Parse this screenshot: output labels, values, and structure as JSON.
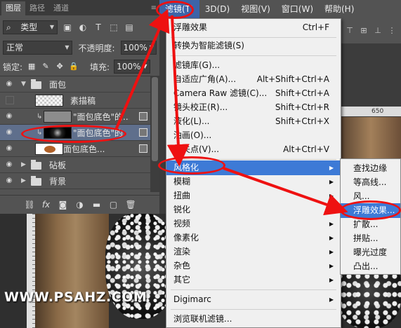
{
  "layers_panel": {
    "tabs": [
      "图层",
      "路径",
      "通道"
    ],
    "filter_kind": "类型",
    "blend_mode": "正常",
    "opacity_label": "不透明度:",
    "opacity_value": "100%",
    "lock_label": "锁定:",
    "fill_label": "填充:",
    "fill_value": "100%",
    "layers": [
      {
        "name": "面包",
        "type": "group",
        "expanded": true,
        "visible": true
      },
      {
        "name": "素描稿",
        "type": "layer",
        "visible": false
      },
      {
        "name": "\"面包底色\"的...",
        "type": "smart-object",
        "visible": true
      },
      {
        "name": "\"面包底色\"的",
        "type": "smart-object",
        "visible": true,
        "selected": true
      },
      {
        "name": "面包底色...",
        "type": "layer",
        "visible": true
      },
      {
        "name": "砧板",
        "type": "group",
        "expanded": false,
        "visible": true
      },
      {
        "name": "背景",
        "type": "group",
        "expanded": false,
        "visible": true
      }
    ]
  },
  "menubar": {
    "items": [
      "滤镜(T)",
      "3D(D)",
      "视图(V)",
      "窗口(W)",
      "帮助(H)"
    ],
    "open_item": "滤镜(T)"
  },
  "filter_menu": {
    "items": [
      {
        "label": "浮雕效果",
        "shortcut": "Ctrl+F"
      },
      {
        "label": "转换为智能滤镜(S)"
      },
      {
        "label": "滤镜库(G)..."
      },
      {
        "label": "自适应广角(A)...",
        "shortcut": "Alt+Shift+Ctrl+A"
      },
      {
        "label": "Camera Raw 滤镜(C)...",
        "shortcut": "Shift+Ctrl+A"
      },
      {
        "label": "镜头校正(R)...",
        "shortcut": "Shift+Ctrl+R"
      },
      {
        "label": "液化(L)...",
        "shortcut": "Shift+Ctrl+X"
      },
      {
        "label": "油画(O)..."
      },
      {
        "label": "消失点(V)...",
        "shortcut": "Alt+Ctrl+V"
      },
      {
        "label": "风格化",
        "submenu": true,
        "highlighted": true
      },
      {
        "label": "模糊",
        "submenu": true
      },
      {
        "label": "扭曲",
        "submenu": true
      },
      {
        "label": "锐化",
        "submenu": true
      },
      {
        "label": "视频",
        "submenu": true
      },
      {
        "label": "像素化",
        "submenu": true
      },
      {
        "label": "渲染",
        "submenu": true
      },
      {
        "label": "杂色",
        "submenu": true
      },
      {
        "label": "其它",
        "submenu": true
      },
      {
        "label": "Digimarc",
        "submenu": true
      },
      {
        "label": "浏览联机滤镜..."
      }
    ]
  },
  "stylize_menu": {
    "items": [
      {
        "label": "查找边缘"
      },
      {
        "label": "等高线..."
      },
      {
        "label": "风..."
      },
      {
        "label": "浮雕效果...",
        "highlighted": true
      },
      {
        "label": "扩散..."
      },
      {
        "label": "拼贴..."
      },
      {
        "label": "曝光过度"
      },
      {
        "label": "凸出..."
      }
    ]
  },
  "ruler": {
    "mark": "650"
  },
  "watermark": "WWW.PSAHZ.COM",
  "colors": {
    "highlight": "#3d7ad6",
    "annotation": "#ee1111",
    "panel": "#535353"
  }
}
